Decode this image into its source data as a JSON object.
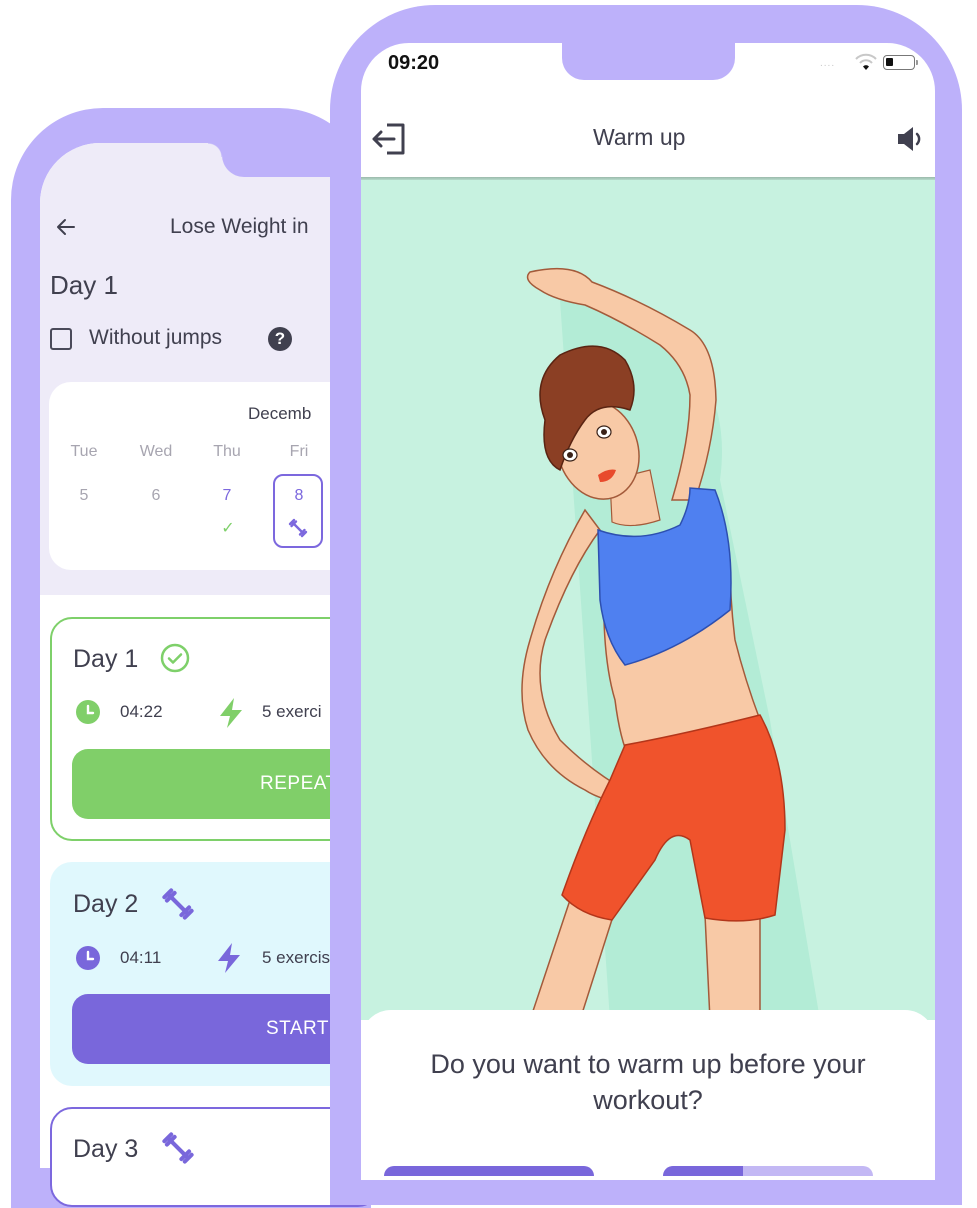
{
  "left_screen": {
    "header": {
      "back_icon": "arrow-left-icon",
      "title": "Lose Weight in"
    },
    "current_day": "Day 1",
    "without_jumps": {
      "label": "Without jumps",
      "checked": false,
      "help_icon": "question-circle-icon"
    },
    "calendar": {
      "month": "Decemb",
      "days": [
        {
          "dow": "Tue",
          "num": "5",
          "status": "none"
        },
        {
          "dow": "Wed",
          "num": "6",
          "status": "none"
        },
        {
          "dow": "Thu",
          "num": "7",
          "status": "done",
          "mark": "✓"
        },
        {
          "dow": "Fri",
          "num": "8",
          "status": "today",
          "icon": "dumbbell-icon"
        }
      ]
    },
    "day_cards": [
      {
        "title": "Day 1",
        "status_icon": "check-circle-icon",
        "time": "04:22",
        "exercises": "5 exerci",
        "button": "REPEAT",
        "accent": "#80cf69"
      },
      {
        "title": "Day 2",
        "status_icon": "dumbbell-icon",
        "time": "04:11",
        "exercises": "5 exercis",
        "button": "START",
        "accent": "#7967db"
      },
      {
        "title": "Day 3",
        "status_icon": "dumbbell-icon"
      }
    ]
  },
  "right_screen": {
    "status_bar": {
      "time": "09:20",
      "signal": "....",
      "wifi_icon": "wifi-icon",
      "battery_icon": "battery-icon"
    },
    "header": {
      "exit_icon": "exit-icon",
      "title": "Warm up",
      "sound_icon": "speaker-icon"
    },
    "illustration": "woman-side-stretch",
    "sheet": {
      "question": "Do you want to warm up before your workout?",
      "button_b_progress": 0.38
    }
  },
  "colors": {
    "frame": "#bdb1fa",
    "accent_purple": "#7967db",
    "accent_green": "#80cf69",
    "illustration_bg": "#c7f2e0",
    "day2_bg": "#e0f8fd"
  }
}
